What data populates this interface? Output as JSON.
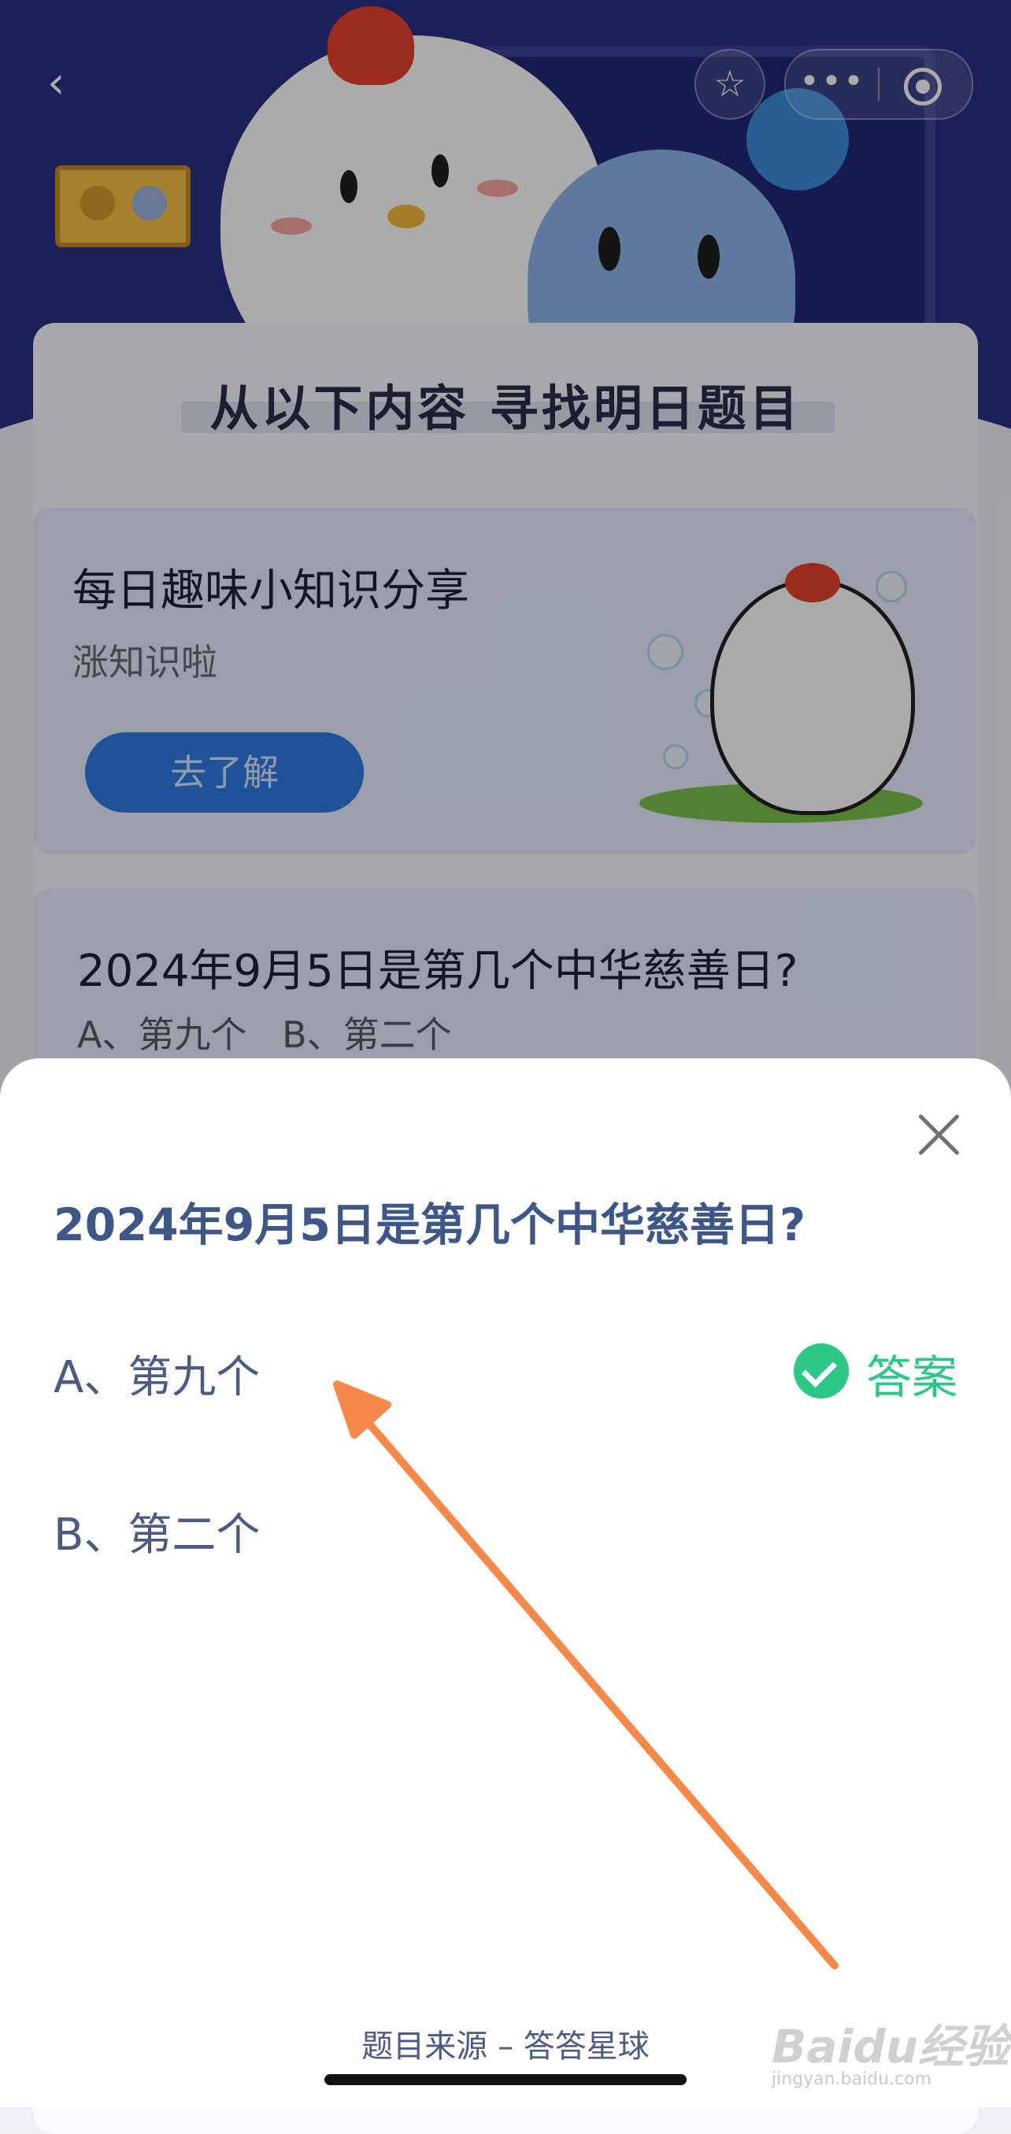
{
  "top_bar": {
    "back_icon": "chevron-left-icon",
    "favorite_icon": "star-icon",
    "more_icon": "ellipsis-icon",
    "close_miniprogram_icon": "target-icon"
  },
  "background": {
    "section_title": "从以下内容  寻找明日题目",
    "info_card": {
      "title": "每日趣味小知识分享",
      "subtitle": "涨知识啦",
      "button": "去了解"
    },
    "question_card": {
      "title": "2024年9月5日是第几个中华慈善日?",
      "options": "A、第九个   B、第二个"
    }
  },
  "sheet": {
    "question": "2024年9月5日是第几个中华慈善日?",
    "options": [
      {
        "label": "A、第九个",
        "is_answer": true
      },
      {
        "label": "B、第二个",
        "is_answer": false
      }
    ],
    "answer_label": "答案",
    "source": "题目来源 – 答答星球",
    "colors": {
      "answer": "#2ec787",
      "text": "#4b5c80",
      "question": "#3f5786"
    }
  },
  "annotation": {
    "color": "#f5894a"
  },
  "watermark": {
    "logo": "Baidu经验",
    "url": "jingyan.baidu.com"
  }
}
